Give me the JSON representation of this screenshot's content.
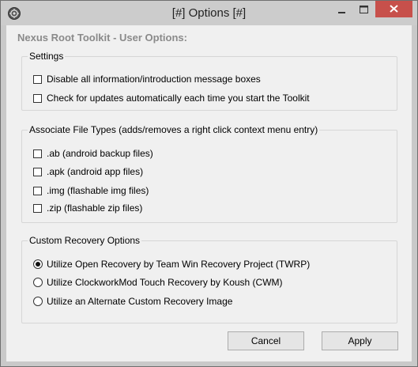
{
  "window": {
    "title": "[#] Options [#]"
  },
  "client": {
    "heading": "Nexus Root Toolkit - User Options:"
  },
  "settings": {
    "legend": "Settings",
    "items": [
      {
        "label": "Disable all information/introduction message boxes",
        "checked": false
      },
      {
        "label": "Check for updates automatically each time you start the Toolkit",
        "checked": false
      }
    ]
  },
  "file_types": {
    "legend": "Associate File Types (adds/removes a right click context menu entry)",
    "items": [
      {
        "label": ".ab (android backup files)",
        "checked": false
      },
      {
        "label": ".apk (android app files)",
        "checked": false
      },
      {
        "label": ".img (flashable img files)",
        "checked": false
      },
      {
        "label": ".zip (flashable zip files)",
        "checked": false
      }
    ]
  },
  "recovery": {
    "legend": "Custom Recovery Options",
    "options": [
      {
        "label": "Utilize Open Recovery by Team Win Recovery Project (TWRP)",
        "selected": true
      },
      {
        "label": "Utilize ClockworkMod Touch Recovery by Koush (CWM)",
        "selected": false
      },
      {
        "label": "Utilize an Alternate Custom Recovery Image",
        "selected": false
      }
    ]
  },
  "buttons": {
    "cancel": "Cancel",
    "apply": "Apply"
  },
  "colors": {
    "close_button": "#c7504b",
    "client_background": "#f0f0f0",
    "frame": "#c9c9c9"
  },
  "icons": {
    "app": "gear-icon",
    "minimize": "minimize-icon",
    "maximize": "maximize-icon",
    "close": "close-icon",
    "radio_selected": "radio-selected-icon"
  }
}
